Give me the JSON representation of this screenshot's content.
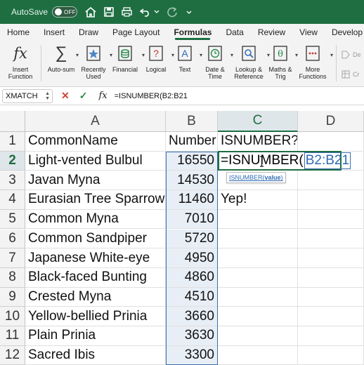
{
  "titlebar": {
    "autosave_label": "AutoSave",
    "toggle_state": "OFF",
    "accent": "#1e6e42"
  },
  "tabs": [
    "Home",
    "Insert",
    "Draw",
    "Page Layout",
    "Formulas",
    "Data",
    "Review",
    "View",
    "Develop"
  ],
  "active_tab": "Formulas",
  "ribbon": {
    "insert_function": "Insert\nFunction",
    "autosum": "Auto-sum",
    "recently_used": "Recently\nUsed",
    "financial": "Financial",
    "logical": "Logical",
    "text": "Text",
    "date_time": "Date &\nTime",
    "lookup_reference": "Lookup &\nReference",
    "maths_trig": "Maths &\nTrig",
    "more_functions": "More\nFunctions",
    "partial_1": "De",
    "partial_2": "Cr"
  },
  "formula_bar": {
    "name_box": "XMATCH",
    "fx_label": "fx",
    "formula": "=ISNUMBER(B2:B21"
  },
  "columns": [
    "A",
    "B",
    "C",
    "D"
  ],
  "rows": [
    {
      "n": "1",
      "a": "CommonName",
      "b": "Number",
      "c": "ISNUMBER?"
    },
    {
      "n": "2",
      "a": "Light-vented Bulbul",
      "b": "16550",
      "c": ""
    },
    {
      "n": "3",
      "a": "Javan Myna",
      "b": "14530",
      "c": ""
    },
    {
      "n": "4",
      "a": "Eurasian Tree Sparrow",
      "b": "11460",
      "c": "Yep!"
    },
    {
      "n": "5",
      "a": "Common Myna",
      "b": "7010",
      "c": ""
    },
    {
      "n": "6",
      "a": "Common Sandpiper",
      "b": "5720",
      "c": ""
    },
    {
      "n": "7",
      "a": "Japanese White-eye",
      "b": "4950",
      "c": ""
    },
    {
      "n": "8",
      "a": "Black-faced Bunting",
      "b": "4860",
      "c": ""
    },
    {
      "n": "9",
      "a": "Crested Myna",
      "b": "4510",
      "c": ""
    },
    {
      "n": "10",
      "a": "Yellow-bellied Prinia",
      "b": "3660",
      "c": ""
    },
    {
      "n": "11",
      "a": "Plain Prinia",
      "b": "3630",
      "c": ""
    },
    {
      "n": "12",
      "a": "Sacred Ibis",
      "b": "3300",
      "c": ""
    }
  ],
  "editing": {
    "prefix": "=ISNUMBER(",
    "ref": "B2:B21"
  },
  "tooltip": {
    "fn": "ISNUMBER",
    "open": "(",
    "arg": "value",
    "close": ")"
  }
}
